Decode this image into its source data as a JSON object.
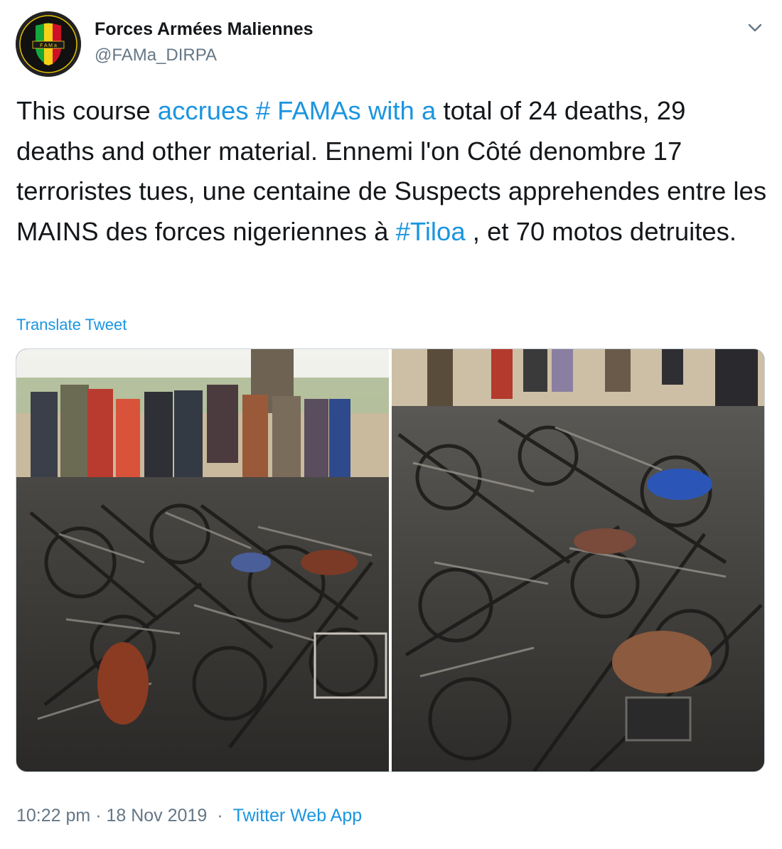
{
  "author": {
    "display_name": "Forces Armées Maliennes",
    "handle": "@FAMa_DIRPA",
    "avatar_text": "F A M a"
  },
  "tweet": {
    "segments": [
      {
        "text": "This course ",
        "link": false
      },
      {
        "text": "accrues # FAMAs with a",
        "link": true
      },
      {
        "text": " total of 24 deaths, 29 deaths and other material. Ennemi l'on Côté denombre 17 terroristes tues, une centaine de Suspects apprehendes entre les MAINS des forces nigeriennes à ",
        "link": false
      },
      {
        "text": "#Tiloa",
        "link": true
      },
      {
        "text": " , et 70 motos detruites.",
        "link": false
      }
    ],
    "translate_label": "Translate Tweet"
  },
  "media": {
    "photos": [
      {
        "name": "burned-motorcycles-photo-1"
      },
      {
        "name": "burned-motorcycles-photo-2"
      }
    ]
  },
  "meta": {
    "time": "10:22 pm",
    "date": "18 Nov 2019",
    "separator": "·",
    "source": "Twitter Web App"
  },
  "icons": {
    "more": "chevron-down-icon"
  },
  "colors": {
    "link": "#1b95e0",
    "secondary": "#657786",
    "text": "#14171a"
  }
}
